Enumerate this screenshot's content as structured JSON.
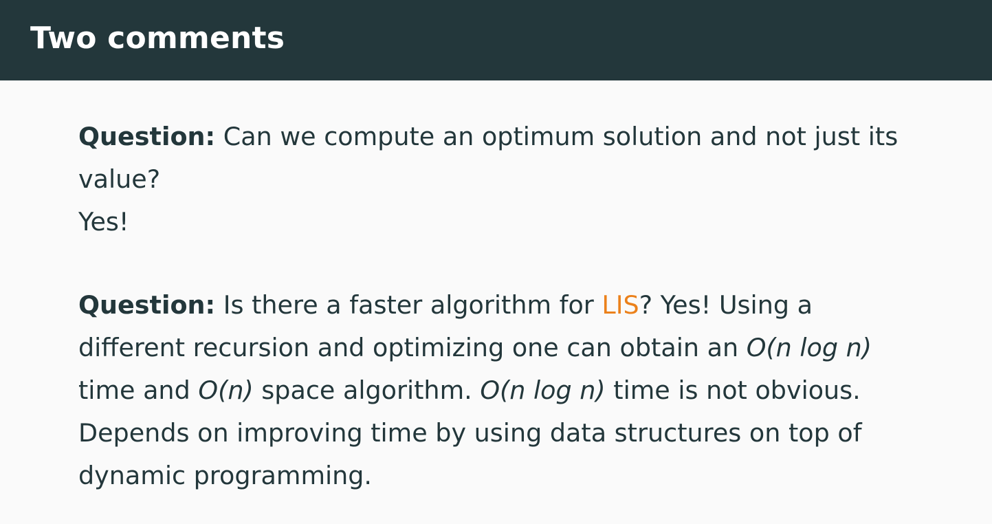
{
  "slide": {
    "title": "Two comments"
  },
  "block1": {
    "q_label": "Question:",
    "q_text": " Can we compute an optimum solution and not just its value?",
    "answer": "Yes!"
  },
  "block2": {
    "q_label": "Question:",
    "q_text_a": " Is there a faster algorithm for ",
    "lis": "LIS",
    "q_text_b": "? Yes! Using a different recursion and optimizing one can obtain an ",
    "math1": "O(n log n)",
    "text_c": " time and ",
    "math2": "O(n)",
    "text_d": " space algorithm.  ",
    "math3": "O(n log n)",
    "text_e": " time is not obvious. Depends on improving time by using data structures on top of dynamic programming."
  },
  "colors": {
    "header": "#23373b",
    "background": "#fafafa",
    "accent": "#eb811b",
    "text": "#23373b"
  }
}
